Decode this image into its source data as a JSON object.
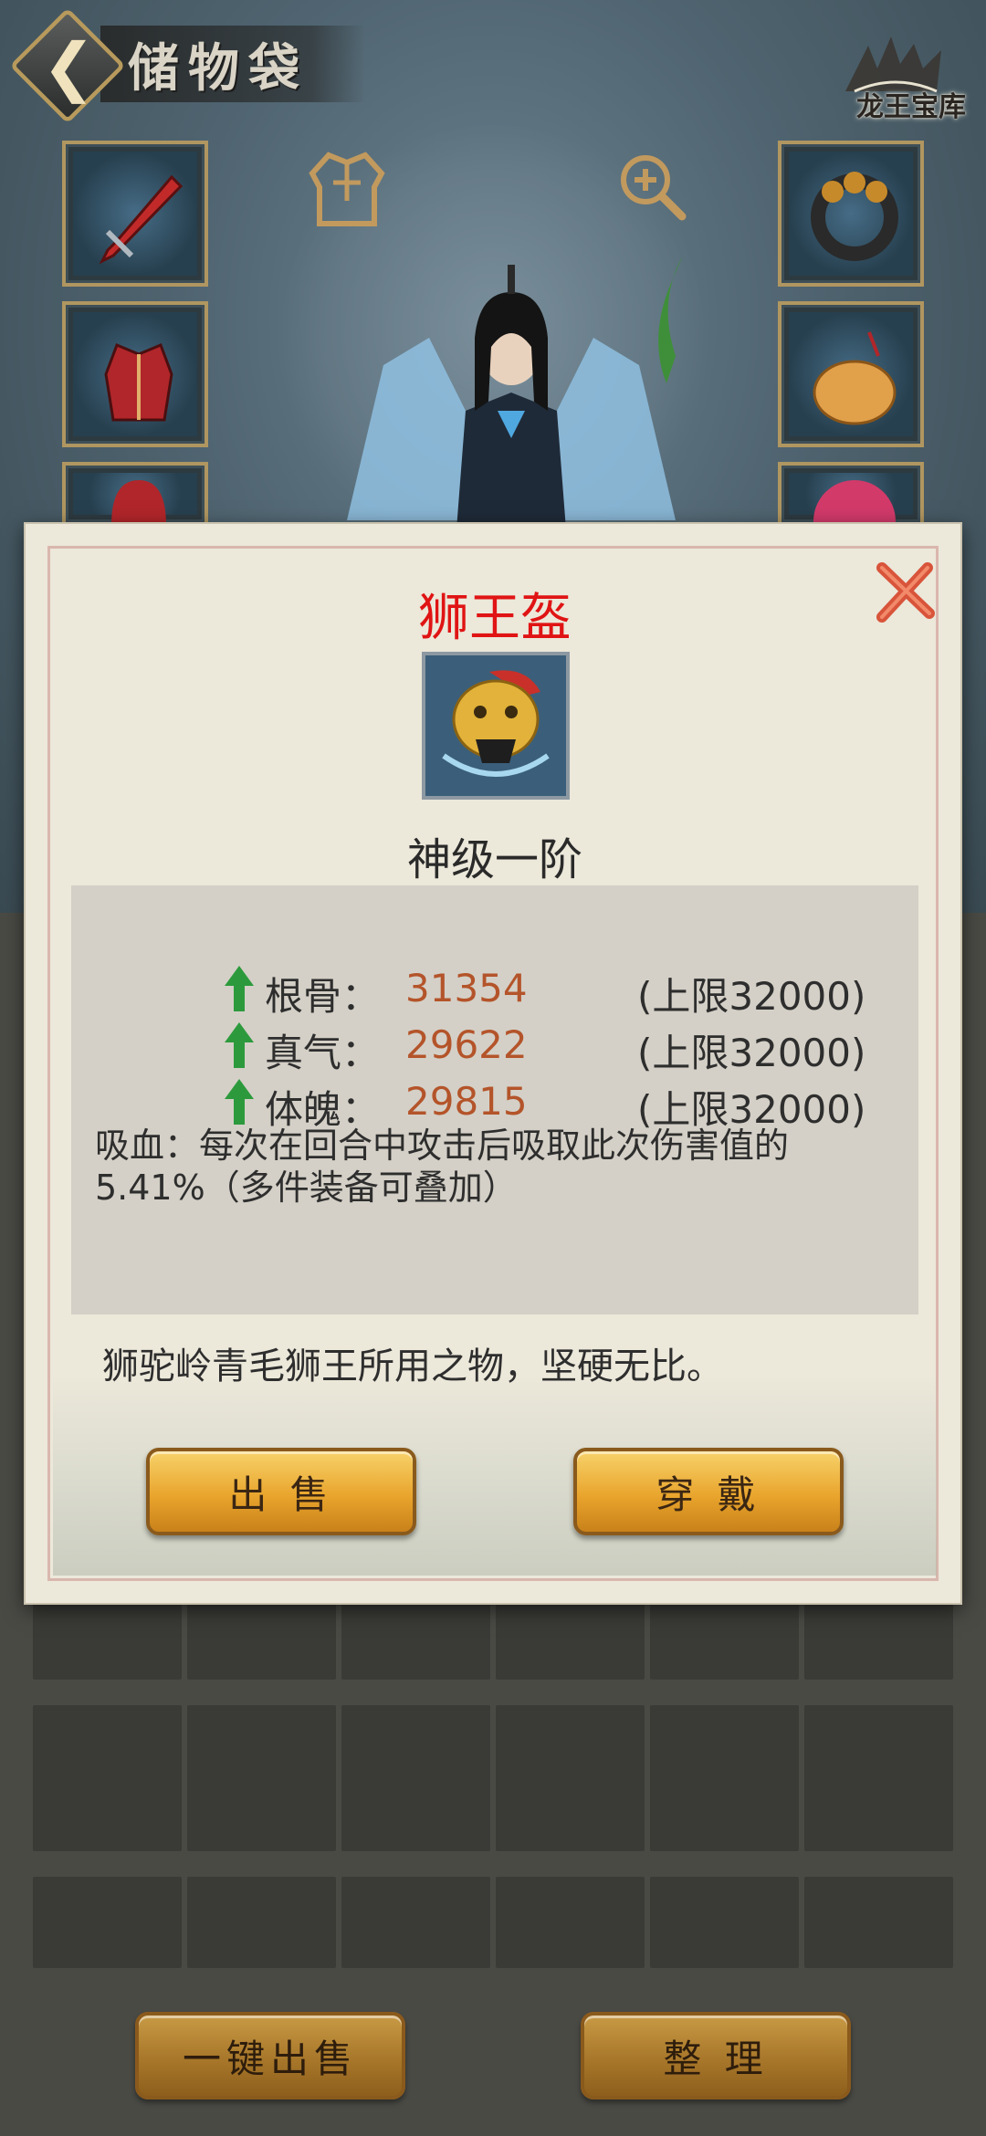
{
  "header": {
    "title": "储物袋",
    "logo_text": "龙王宝库",
    "back_icon": "chevron-left-icon"
  },
  "equipment_slots": {
    "left": [
      "weapon",
      "armor",
      "helmet"
    ],
    "right": [
      "ring",
      "amulet",
      "orb"
    ]
  },
  "item": {
    "name": "狮王盔",
    "name_color": "#e01414",
    "grade": "神级一阶",
    "stats": [
      {
        "label": "根骨：",
        "value": "31354",
        "cap": "(上限32000)"
      },
      {
        "label": "真气：",
        "value": "29622",
        "cap": "(上限32000)"
      },
      {
        "label": "体魄：",
        "value": "29815",
        "cap": "(上限32000)"
      }
    ],
    "effect": "吸血：每次在回合中攻击后吸取此次伤害值的5.41%（多件装备可叠加）",
    "flavor": "狮驼岭青毛狮王所用之物，坚硬无比。"
  },
  "modal_buttons": {
    "sell": "出 售",
    "equip": "穿 戴"
  },
  "bottom_buttons": {
    "sell_all": "一键出售",
    "sort": "整 理"
  },
  "colors": {
    "value": "#b4542a",
    "arrow": "#2c9a3c",
    "gold_button": "#e9a52d"
  }
}
